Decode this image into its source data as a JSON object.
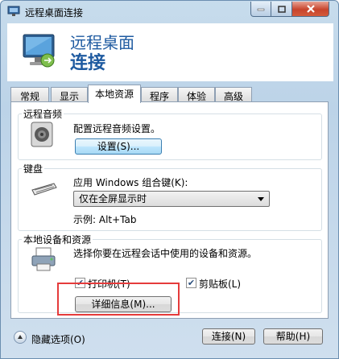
{
  "window": {
    "title": "远程桌面连接",
    "header_line1": "远程桌面",
    "header_line2": "连接"
  },
  "tabs": [
    {
      "label": "常规"
    },
    {
      "label": "显示"
    },
    {
      "label": "本地资源",
      "active": true
    },
    {
      "label": "程序"
    },
    {
      "label": "体验"
    },
    {
      "label": "高级"
    }
  ],
  "audio": {
    "group_title": "远程音频",
    "description": "配置远程音频设置。",
    "settings_button": "设置(S)..."
  },
  "keyboard": {
    "group_title": "键盘",
    "label": "应用 Windows 组合键(K):",
    "selected": "仅在全屏显示时",
    "example": "示例: Alt+Tab"
  },
  "devices": {
    "group_title": "本地设备和资源",
    "description": "选择你要在远程会话中使用的设备和资源。",
    "printer_label": "打印机(T)",
    "printer_checked": true,
    "clipboard_label": "剪贴板(L)",
    "clipboard_checked": true,
    "details_button": "详细信息(M)..."
  },
  "footer": {
    "hide_options": "隐藏选项(O)",
    "connect_button": "连接(N)",
    "help_button": "帮助(H)"
  },
  "colors": {
    "header_text": "#1e5aa0",
    "highlight_border": "#e53b3b"
  }
}
